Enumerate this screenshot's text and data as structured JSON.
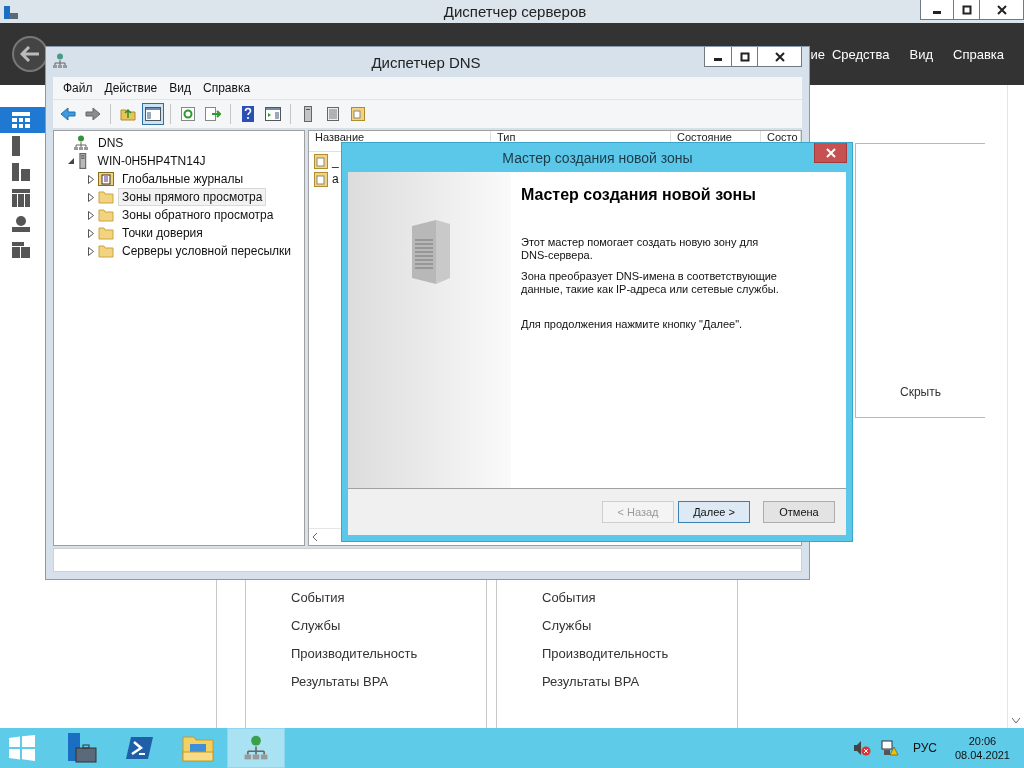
{
  "server_manager": {
    "title": "Диспетчер серверов",
    "menu": [
      "ие",
      "Средства",
      "Вид",
      "Справка"
    ],
    "sidebar_items": [
      {
        "kind": "dashboard",
        "selected": true
      },
      {
        "kind": "server",
        "selected": false
      },
      {
        "kind": "servers",
        "selected": false
      },
      {
        "kind": "cluster",
        "selected": false
      },
      {
        "kind": "dns",
        "selected": false
      },
      {
        "kind": "files",
        "selected": false
      }
    ],
    "hide_link": "Скрыть",
    "tiles": [
      {
        "links": [
          "События",
          "Службы",
          "Производительность",
          "Результаты BPA"
        ]
      },
      {
        "links": [
          "События",
          "Службы",
          "Производительность",
          "Результаты BPA"
        ]
      }
    ]
  },
  "dns_manager": {
    "title": "Диспетчер DNS",
    "menu": [
      "Файл",
      "Действие",
      "Вид",
      "Справка"
    ],
    "toolbar": [
      {
        "kind": "back",
        "pressed": false
      },
      {
        "kind": "forward",
        "pressed": false
      },
      {
        "kind": "separator"
      },
      {
        "kind": "up",
        "pressed": false
      },
      {
        "kind": "tree",
        "pressed": true
      },
      {
        "kind": "separator"
      },
      {
        "kind": "refresh",
        "pressed": false
      },
      {
        "kind": "export",
        "pressed": false
      },
      {
        "kind": "separator"
      },
      {
        "kind": "help",
        "pressed": false
      },
      {
        "kind": "pane",
        "pressed": false
      },
      {
        "kind": "separator"
      },
      {
        "kind": "server",
        "pressed": false
      },
      {
        "kind": "list",
        "pressed": false
      },
      {
        "kind": "zone",
        "pressed": false
      }
    ],
    "tree": [
      {
        "label": "DNS",
        "kind": "dns",
        "selected": false,
        "children": [
          {
            "label": "WIN-0H5HP4TN14J",
            "kind": "server",
            "expanded": true,
            "selected": false,
            "children": [
              {
                "label": "Глобальные журналы",
                "kind": "log",
                "expanded": false,
                "selected": false
              },
              {
                "label": "Зоны прямого просмотра",
                "kind": "folder",
                "expanded": false,
                "selected": true
              },
              {
                "label": "Зоны обратного просмотра",
                "kind": "folder",
                "expanded": false,
                "selected": false
              },
              {
                "label": "Точки доверия",
                "kind": "folder",
                "expanded": false,
                "selected": false
              },
              {
                "label": "Серверы условной пересылки",
                "kind": "folder",
                "expanded": false,
                "selected": false
              }
            ]
          }
        ]
      }
    ],
    "columns": [
      "Название",
      "Тип",
      "Состояние",
      "Состо"
    ],
    "rows": [
      {
        "name": "_"
      },
      {
        "name": "a"
      }
    ]
  },
  "wizard": {
    "title": "Мастер создания новой зоны",
    "heading": "Мастер создания новой зоны",
    "paragraphs": [
      "Этот мастер помогает создать новую зону для DNS-сервера.",
      "Зона преобразует DNS-имена в соответствующие данные, такие как IP-адреса или сетевые службы.",
      "Для продолжения нажмите кнопку \"Далее\"."
    ],
    "buttons": [
      {
        "label": "< Назад",
        "disabled": true,
        "default": false
      },
      {
        "label": "Далее >",
        "disabled": false,
        "default": true
      },
      {
        "label": "Отмена",
        "disabled": false,
        "default": false
      }
    ]
  },
  "taskbar": {
    "apps": [
      {
        "kind": "server-manager",
        "active": false
      },
      {
        "kind": "powershell",
        "active": false
      },
      {
        "kind": "explorer",
        "active": false
      },
      {
        "kind": "dns",
        "active": true
      }
    ],
    "language": "РУС",
    "time": "20:06",
    "date": "08.04.2021"
  }
}
